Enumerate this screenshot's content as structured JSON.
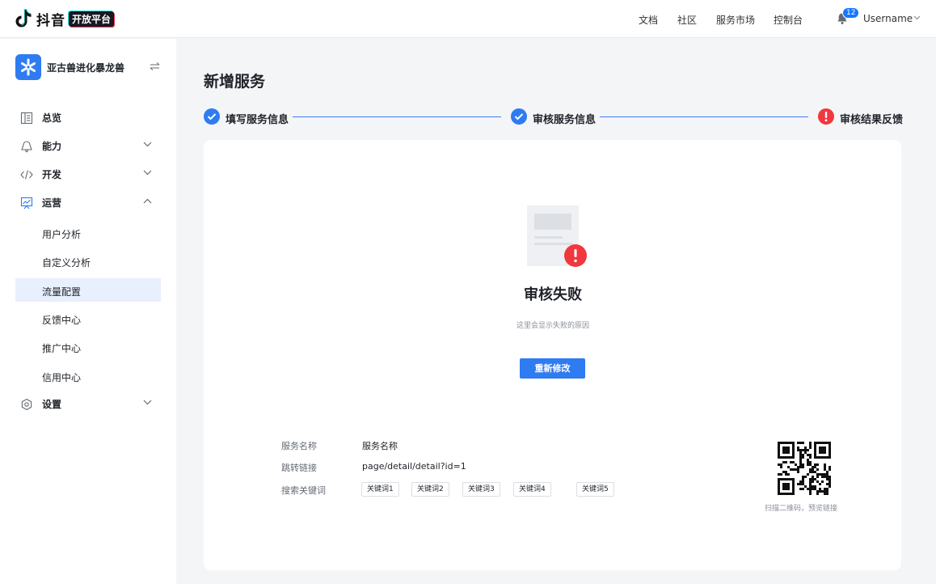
{
  "header": {
    "brand": "抖音",
    "badge": "开放平台",
    "nav": [
      "文档",
      "社区",
      "服务市场",
      "控制台"
    ],
    "notification_count": "12",
    "username": "Username"
  },
  "sidebar": {
    "app_name": "亚古兽进化暴龙兽",
    "items": [
      {
        "label": "总览",
        "icon": "dashboard-icon"
      },
      {
        "label": "能力",
        "icon": "capability-icon"
      },
      {
        "label": "开发",
        "icon": "code-icon"
      },
      {
        "label": "运营",
        "icon": "chart-icon"
      },
      {
        "label": "设置",
        "icon": "settings-icon"
      }
    ],
    "sub_items": [
      "用户分析",
      "自定义分析",
      "流量配置",
      "反馈中心",
      "推广中心",
      "信用中心"
    ],
    "active_sub_item": "流量配置"
  },
  "main": {
    "title": "新增服务",
    "steps": [
      {
        "label": "填写服务信息",
        "status": "done"
      },
      {
        "label": "审核服务信息",
        "status": "done"
      },
      {
        "label": "审核结果反馈",
        "status": "error"
      }
    ],
    "result_title": "审核失败",
    "result_subtitle": "这里会显示失败的原因",
    "retry_label": "重新修改",
    "info": {
      "name_key": "服务名称",
      "name_val": "服务名称",
      "link_key": "跳转链接",
      "link_val": "page/detail/detail?id=1",
      "keywords_key": "搜索关键词",
      "keywords": [
        "关键词1",
        "关键词2",
        "关键词3",
        "关键词4",
        "关键词5"
      ]
    },
    "qr_caption": "扫描二维码，预览链接"
  },
  "colors": {
    "accent": "#2f7bf2",
    "error": "#f0383e",
    "active_bg": "#e8f0fe"
  }
}
